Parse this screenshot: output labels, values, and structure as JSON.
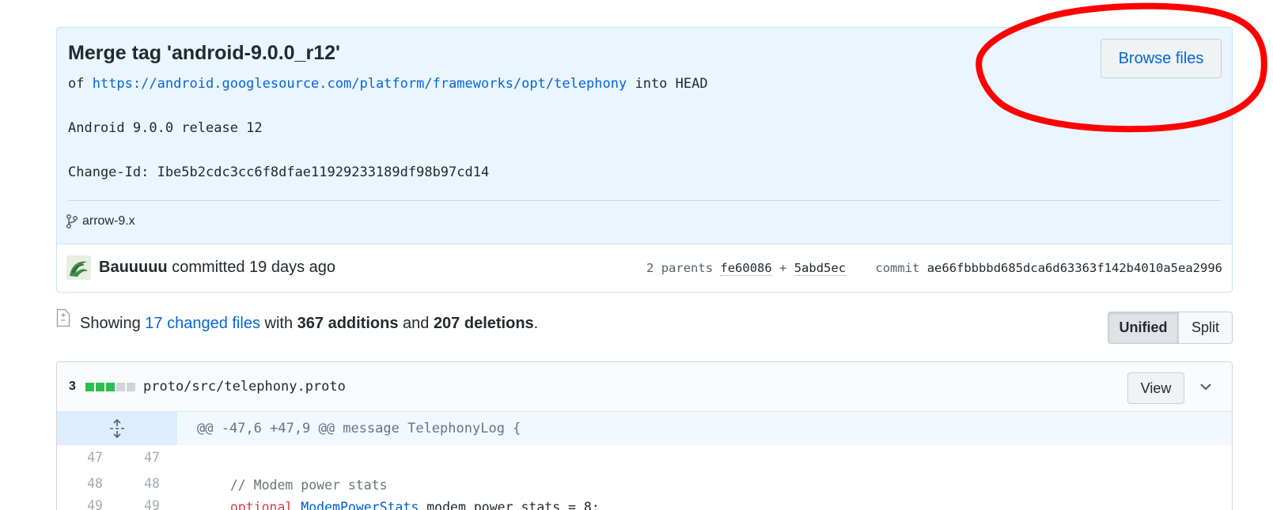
{
  "commit": {
    "title": "Merge tag 'android-9.0.0_r12'",
    "desc_prefix": "of ",
    "desc_link": "https://android.googlesource.com/platform/frameworks/opt/telephony",
    "desc_suffix": " into HEAD",
    "desc_line2": "Android 9.0.0 release 12",
    "desc_line3": "Change-Id: Ibe5b2cdc3cc6f8dfae11929233189df98b97cd14",
    "browse_label": "Browse files",
    "branch": "arrow-9.x",
    "author": "Bauuuuu",
    "committed_text": " committed 19 days ago",
    "parents_label": "2 parents",
    "parent1": "fe60086",
    "parent_sep": " + ",
    "parent2": "5abd5ec",
    "commit_label": "commit",
    "commit_sha": "ae66fbbbbd685dca6d63363f142b4010a5ea2996"
  },
  "toc": {
    "showing": "Showing ",
    "changed_files": "17 changed files",
    "with": " with ",
    "additions": "367 additions",
    "and": " and ",
    "deletions": "207 deletions",
    "period": ".",
    "unified_label": "Unified",
    "split_label": "Split"
  },
  "file": {
    "diffstat_count": "3",
    "diffstat": {
      "added_blocks": 3,
      "neutral_blocks": 2
    },
    "path": "proto/src/telephony.proto",
    "view_label": "View",
    "hunk_header": "@@ -47,6 +47,9 @@ message TelephonyLog {",
    "lines": [
      {
        "old": "47",
        "new": "47",
        "text": ""
      },
      {
        "old": "48",
        "new": "48",
        "text": "  // Modem power stats"
      },
      {
        "old": "49",
        "new": "49",
        "kw": "optional",
        "type": "ModemPowerStats",
        "rest": " modem_power_stats = 8;"
      }
    ]
  },
  "colors": {
    "link": "#0366d6",
    "commit_bg": "#eaf5ff",
    "diff_add": "#2cbe4e",
    "annotation": "#ff0000"
  }
}
